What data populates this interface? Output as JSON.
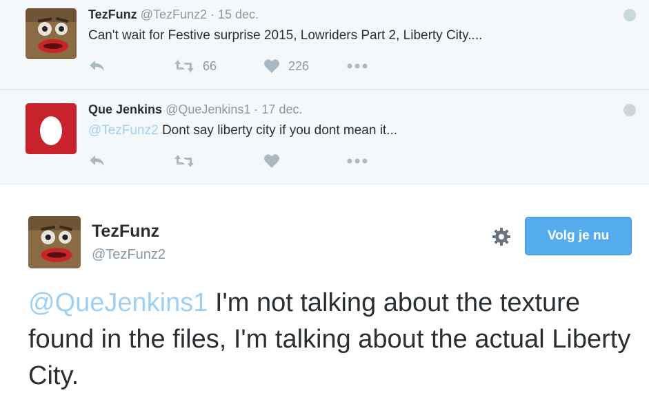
{
  "tweets": [
    {
      "name": "TezFunz",
      "handle": "@TezFunz2",
      "date": "· 15 dec.",
      "mention": "",
      "text": "Can't wait for Festive surprise 2015, Lowriders Part 2, Liberty City....",
      "retweets": "66",
      "likes": "226",
      "avatar_icon": "pepe-face-avatar"
    },
    {
      "name": "Que Jenkins",
      "handle": "@QueJenkins1",
      "date": "· 17 dec.",
      "mention": "@TezFunz2",
      "text": "Dont say liberty city if you dont mean it...",
      "retweets": "",
      "likes": "",
      "avatar_icon": "egg-avatar"
    }
  ],
  "main_tweet": {
    "name": "TezFunz",
    "handle": "@TezFunz2",
    "follow_label": "Volg je nu",
    "mention": "@QueJenkins1",
    "text": " I'm not talking about the texture found in the files, I'm talking about the actual Liberty City."
  },
  "colors": {
    "link": "#9fd0f4",
    "follow_button": "#55acee",
    "egg_background": "#c8232c",
    "muted": "#8899a6"
  }
}
